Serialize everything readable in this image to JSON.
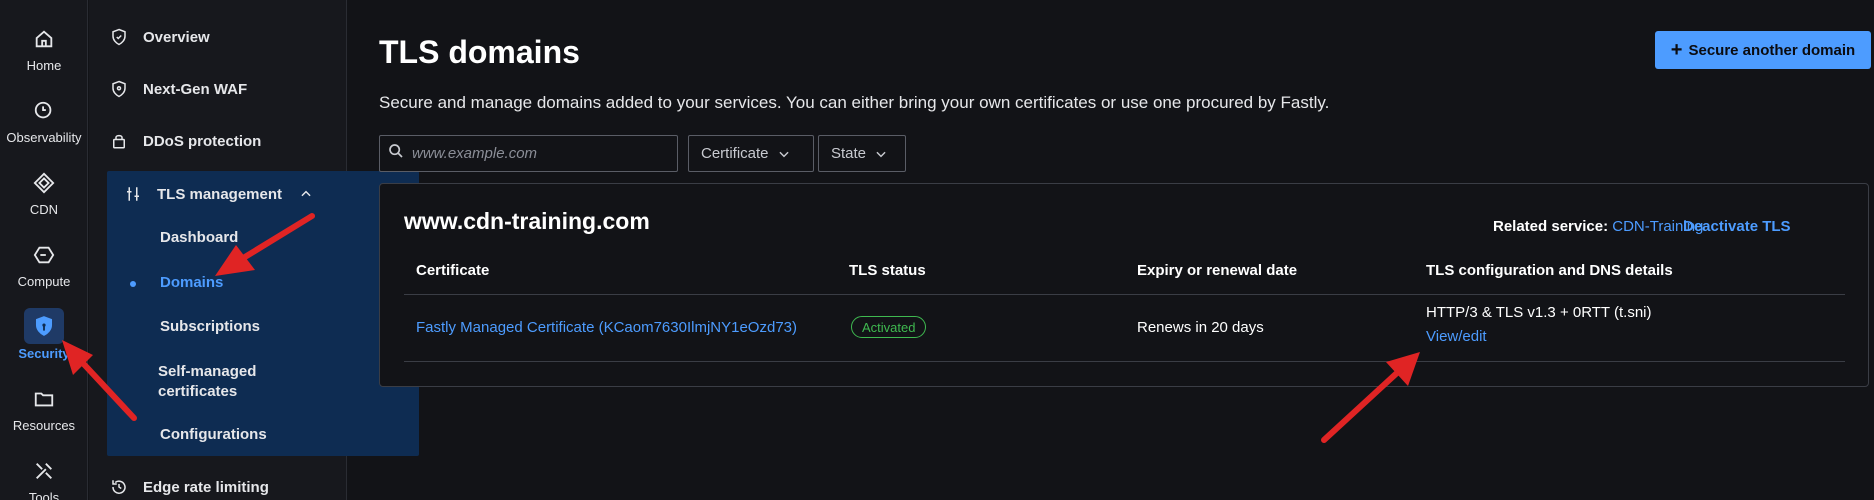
{
  "rail": {
    "items": [
      {
        "label": "Home",
        "icon": "home-icon"
      },
      {
        "label": "Observability",
        "icon": "observability-icon"
      },
      {
        "label": "CDN",
        "icon": "cdn-icon"
      },
      {
        "label": "Compute",
        "icon": "compute-icon"
      },
      {
        "label": "Security",
        "icon": "shield-icon",
        "active": true
      },
      {
        "label": "Resources",
        "icon": "folder-icon"
      },
      {
        "label": "Tools",
        "icon": "tools-icon"
      }
    ]
  },
  "subnav": {
    "overview": "Overview",
    "ngwaf": "Next-Gen WAF",
    "ddos": "DDoS protection",
    "tls": "TLS management",
    "tls_items": {
      "dashboard": "Dashboard",
      "domains": "Domains",
      "subscriptions": "Subscriptions",
      "self_managed_1": "Self-managed",
      "self_managed_2": "certificates",
      "configurations": "Configurations"
    },
    "edge_rate": "Edge rate limiting"
  },
  "main": {
    "title": "TLS domains",
    "description": "Secure and manage domains added to your services. You can either bring your own certificates or use one procured by Fastly.",
    "secure_button": "Secure another domain",
    "search_placeholder": "www.example.com",
    "filters": {
      "certificate": "Certificate",
      "state": "State"
    }
  },
  "domain_card": {
    "domain": "www.cdn-training.com",
    "related_label": "Related service:",
    "related_service": "CDN-Training",
    "deactivate": "Deactivate TLS",
    "columns": [
      "Certificate",
      "TLS status",
      "Expiry or renewal date",
      "TLS configuration and DNS details"
    ],
    "row": {
      "certificate": "Fastly Managed Certificate (KCaom7630IlmjNY1eOzd73)",
      "status": "Activated",
      "expiry": "Renews in 20 days",
      "config": "HTTP/3 & TLS v1.3 + 0RTT (t.sni)",
      "view_edit": "View/edit"
    }
  },
  "colors": {
    "accent": "#4d9cff",
    "active_group_bg": "#0e2c52",
    "success": "#3fb950",
    "annotation_arrow": "#e02424",
    "background": "#121317"
  }
}
